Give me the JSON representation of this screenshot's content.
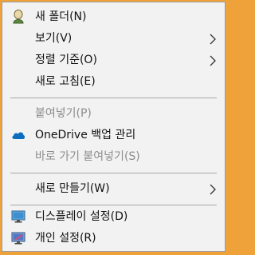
{
  "menu": {
    "items": [
      {
        "label": "새 폴더(N)",
        "icon": "person-icon",
        "disabled": false,
        "submenu": false
      },
      {
        "label": "보기(V)",
        "icon": null,
        "disabled": false,
        "submenu": true
      },
      {
        "label": "정렬 기준(O)",
        "icon": null,
        "disabled": false,
        "submenu": true
      },
      {
        "label": "새로 고침(E)",
        "icon": null,
        "disabled": false,
        "submenu": false
      },
      {
        "label": "붙여넣기(P)",
        "icon": null,
        "disabled": true,
        "submenu": false
      },
      {
        "label": "OneDrive 백업 관리",
        "icon": "onedrive-cloud-icon",
        "disabled": false,
        "submenu": false
      },
      {
        "label": "바로 가기 붙여넣기(S)",
        "icon": null,
        "disabled": true,
        "submenu": false
      },
      {
        "label": "새로 만들기(W)",
        "icon": null,
        "disabled": false,
        "submenu": true
      },
      {
        "label": "디스플레이 설정(D)",
        "icon": "display-settings-icon",
        "disabled": false,
        "submenu": false
      },
      {
        "label": "개인 설정(R)",
        "icon": "personalize-icon",
        "disabled": false,
        "submenu": false
      }
    ]
  },
  "colors": {
    "background": "#f0a23a",
    "menu_bg": "#f2f2f2",
    "text": "#111111",
    "disabled_text": "#8c8c8c",
    "onedrive_blue": "#0f6cbd"
  }
}
